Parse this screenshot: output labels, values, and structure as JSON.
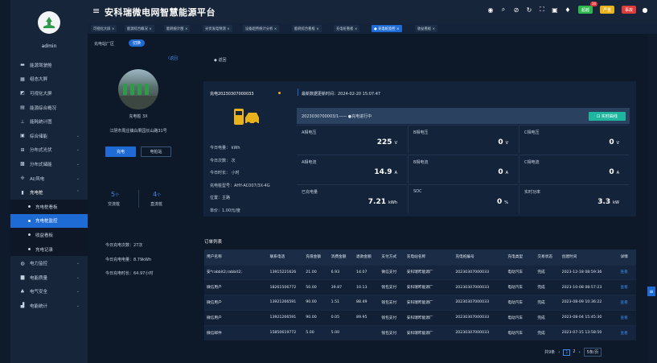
{
  "header": {
    "title": "安科瑞微电网智慧能源平台",
    "badges": [
      {
        "label": "超越",
        "count": "14",
        "color": "#2db84d"
      },
      {
        "label": "严重",
        "count": "",
        "color": "#e8b21c"
      },
      {
        "label": "事故",
        "count": "",
        "color": "#e03b3b"
      }
    ]
  },
  "user": {
    "name": "admin"
  },
  "tabs": [
    "可视化大屏 ×",
    "能源综合概况 ×",
    "能耗统计图 ×",
    "光伏发电预测 ×",
    "设备趋势统计分析 ×",
    "能耗综合看板 ×",
    "充电桩看板 ×",
    "● 充电桩监控 ×",
    "收益看板 ×"
  ],
  "menu": [
    {
      "label": "能源驾驶舱",
      "icon": "▬",
      "chev": false
    },
    {
      "label": "组态大屏",
      "icon": "▦",
      "chev": false
    },
    {
      "label": "可视化大屏",
      "icon": "◩",
      "chev": false
    },
    {
      "label": "能源综合概况",
      "icon": "▤",
      "chev": false
    },
    {
      "label": "能耗统计图",
      "icon": "⊥",
      "chev": false
    },
    {
      "label": "综合储能",
      "icon": "▣",
      "chev": true
    },
    {
      "label": "分布式光伏",
      "icon": "⊞",
      "chev": true
    },
    {
      "label": "分布式储能",
      "icon": "▩",
      "chev": true
    },
    {
      "label": "AI/风电",
      "icon": "✢",
      "chev": true
    },
    {
      "label": "充电桩",
      "icon": "▮",
      "chev": true,
      "open": true
    },
    {
      "label": "充电桩看板",
      "sub": true
    },
    {
      "label": "充电桩监控",
      "sub": true,
      "active": true
    },
    {
      "label": "收益看板",
      "sub": true
    },
    {
      "label": "充电记录",
      "sub": true
    },
    {
      "label": "电力监控",
      "icon": "◍",
      "chev": true
    },
    {
      "label": "电能质量",
      "icon": "▆",
      "chev": true
    },
    {
      "label": "电气安全",
      "icon": "♣",
      "chev": true
    },
    {
      "label": "电能统计",
      "icon": "▟",
      "chev": true
    }
  ],
  "station": {
    "crumb": "充电站厂区",
    "switch": "切换",
    "back": "〈返回",
    "name": "充电桩 3X",
    "address": "江阴市周庄镇白果园长山路31号",
    "btn_charging": "充电",
    "btn_elec": "电桩站",
    "stat1_num": "5",
    "stat1_unit": "个",
    "stat1_label": "交流桩",
    "stat2_num": "4",
    "stat2_unit": "个",
    "stat2_label": "直流桩",
    "today_count": "今日充电次数：27次",
    "today_energy": "今日充电电量：8.79kWh",
    "today_time": "今日充电时长：64.97小时"
  },
  "detail": {
    "back": "返回",
    "pile": "充电20230307000033",
    "update": "最新数据更新时间：2024-02-20 15:07:47",
    "gun": "2023030700003/1—— ●充电进行中",
    "realtime_btn": "实时曲线",
    "info": [
      "今日电量：   kWh",
      "今日次数：   次",
      "今日时长：   小时",
      "充电桩型号：AHY-AC007/3X-4G",
      "位置：主路",
      "单价：1.00元/度"
    ],
    "cells": [
      {
        "label": "A相电压",
        "value": "225",
        "unit": "V"
      },
      {
        "label": "B相电压",
        "value": "0",
        "unit": "V"
      },
      {
        "label": "C相电压",
        "value": "0",
        "unit": "V"
      },
      {
        "label": "A相电流",
        "value": "14.9",
        "unit": "A"
      },
      {
        "label": "B相电流",
        "value": "0",
        "unit": "A"
      },
      {
        "label": "C相电流",
        "value": "0",
        "unit": "A"
      },
      {
        "label": "已充电量",
        "value": "7.21",
        "unit": "kWh"
      },
      {
        "label": "SOC",
        "value": "0",
        "unit": "%"
      },
      {
        "label": "实时功率",
        "value": "3.3",
        "unit": "kW"
      }
    ]
  },
  "orders": {
    "title": "订单列表",
    "columns": [
      "用户名称",
      "联系电话",
      "充值金额",
      "消费金额",
      "退款金额",
      "支付方式",
      "充电站名称",
      "充电桩编号",
      "充电类型",
      "交易状态",
      "创建时间",
      "详情"
    ],
    "rows": [
      [
        "安*rabbit2;rabbit2;",
        "13915221626",
        "21.00",
        "6.93",
        "14.07",
        "微信支付",
        "安科瑞昨能源厂",
        "20230307000033",
        "电动汽车",
        "完成",
        "2023-12-18 08:59:36",
        "查看"
      ],
      [
        "微信用户",
        "18261506772",
        "50.00",
        "39.87",
        "10.13",
        "钱包支付",
        "安科瑞昨能源厂",
        "20230307000033",
        "电动汽车",
        "完成",
        "2023-10-08 08:57:23",
        "查看"
      ],
      [
        "微信用户",
        "13921266591",
        "90.00",
        "1.51",
        "88.49",
        "钱包支付",
        "安科瑞昨能源厂",
        "20230307000033",
        "电动汽车",
        "完成",
        "2023-08-09 10:36:22",
        "查看"
      ],
      [
        "微信用户",
        "13921266591",
        "90.00",
        "0.05",
        "89.95",
        "钱包支付",
        "安科瑞昨能源厂",
        "20230307000033",
        "电动汽车",
        "完成",
        "2023-08-04 15:45:30",
        "查看"
      ],
      [
        "微信邮件",
        "15850619772",
        "5.00",
        "5.00",
        "",
        "钱包支付",
        "安科瑞昨能源厂",
        "20230307000033",
        "电动汽车",
        "完成",
        "2023-07-15 13:58:50",
        "查看"
      ]
    ],
    "total": "共9条",
    "pages": [
      "1",
      "2"
    ],
    "page_size": "5条/页"
  }
}
